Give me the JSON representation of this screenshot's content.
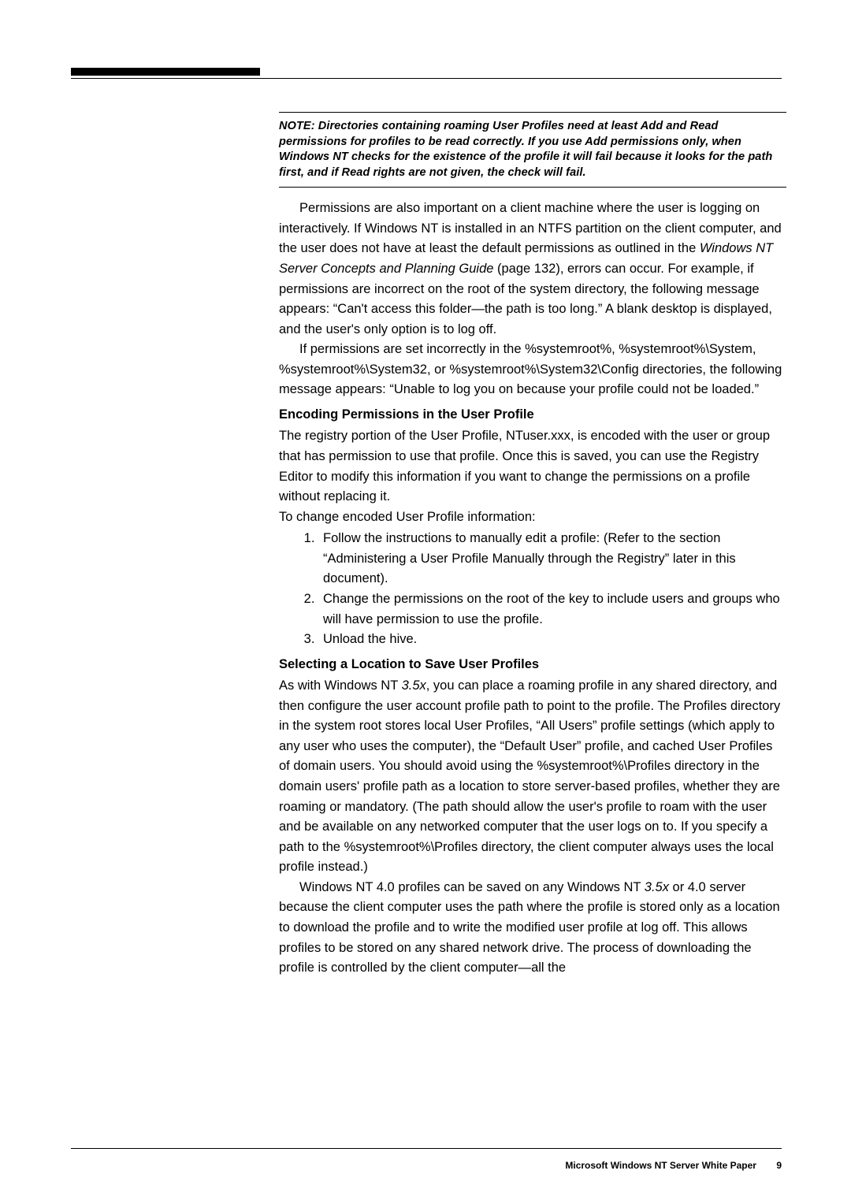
{
  "note": {
    "label": "NOTE",
    "text": ": Directories containing roaming User Profiles need at least Add and Read permissions for profiles to be read correctly. If you use Add permissions only, when Windows NT checks for the existence of the profile it will fail because it looks for the path first, and if Read rights are not given, the check will fail."
  },
  "para1a": "Permissions are also important on a client machine where the user is logging on interactively. If Windows NT is installed in an NTFS partition on the client computer, and the user does not have at least the default permissions as outlined in the ",
  "para1_ref": "Windows NT Server Concepts and Planning Guide",
  "para1b": " (page 132), errors can occur. For example, if permissions are incorrect on the root of the system directory, the following message appears: “Can't access this folder—the path is too long.” A blank desktop is displayed, and the user's only option is to log off.",
  "para2": "If permissions are set incorrectly in the %systemroot%, %systemroot%\\System, %systemroot%\\System32, or %systemroot%\\System32\\Config directories, the following message appears: “Unable to log you on because your profile could not be loaded.”",
  "heading1": "Encoding Permissions in the User Profile",
  "para3": "The registry portion of the User Profile, NTuser.xxx, is encoded with the user or group that has permission to use that profile. Once this is saved, you can use the Registry Editor to modify this information if you want to change the permissions on a profile without replacing it.",
  "para4": "To change encoded User Profile information:",
  "steps": [
    "Follow the instructions to manually edit a profile: (Refer to the section “Administering a User Profile Manually through the Registry” later in this document).",
    "Change the permissions on the root of the key to include users and groups who will have permission to use the profile.",
    "Unload the hive."
  ],
  "heading2": "Selecting a Location to Save User Profiles",
  "para5a": "As with Windows NT ",
  "para5_ref1": "3.5x",
  "para5b": ", you can place a roaming profile in any shared directory, and then configure the user account profile path to point to the profile. The Profiles directory in the system root stores local User Profiles, “All Users” profile settings (which apply to any user who uses the computer), the “Default User” profile, and cached User Profiles of domain users. You should avoid using the %systemroot%\\Profiles directory in the domain users' profile path as a location to store server-based profiles, whether they are roaming or mandatory. (The path should allow the user's profile to roam with the user and be available on any networked computer that the user logs on to. If you specify a path to the %systemroot%\\Profiles directory, the client computer always uses the local profile instead.)",
  "para6a": "Windows NT 4.0 profiles can be saved on any Windows NT ",
  "para6_ref": "3.5x",
  "para6b": " or 4.0 server because the client computer uses the path where the profile is stored only as a location to download the profile and to write the modified user profile at log off. This allows profiles to be stored on any shared network drive. The process of downloading the profile is controlled by the client computer—all the",
  "footer": {
    "title": "Microsoft Windows NT Server White Paper",
    "page": "9"
  }
}
